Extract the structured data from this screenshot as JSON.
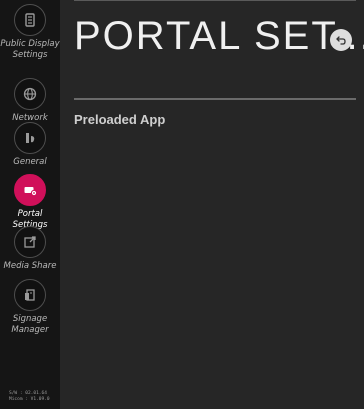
{
  "sidebar": {
    "items": [
      {
        "label": "Public Display Settings",
        "icon": "display-settings-icon",
        "active": false
      },
      {
        "label": "Network",
        "icon": "network-icon",
        "active": false
      },
      {
        "label": "General",
        "icon": "general-icon",
        "active": false
      },
      {
        "label": "Portal Settings",
        "icon": "portal-settings-icon",
        "active": true
      },
      {
        "label": "Media Share",
        "icon": "media-share-icon",
        "active": false
      },
      {
        "label": "Signage Manager",
        "icon": "signage-manager-icon",
        "active": false
      }
    ],
    "version_line1": "S/W : 02.01.64",
    "version_line2": "Micom : V1.09.0"
  },
  "header": {
    "title": "PORTAL SET...",
    "back_icon": "back-arrow-icon"
  },
  "menu": {
    "items": [
      {
        "label": "Preloaded App"
      }
    ]
  },
  "colors": {
    "accent": "#d0105a",
    "sidebar_bg": "#151515",
    "main_bg": "#262626"
  }
}
